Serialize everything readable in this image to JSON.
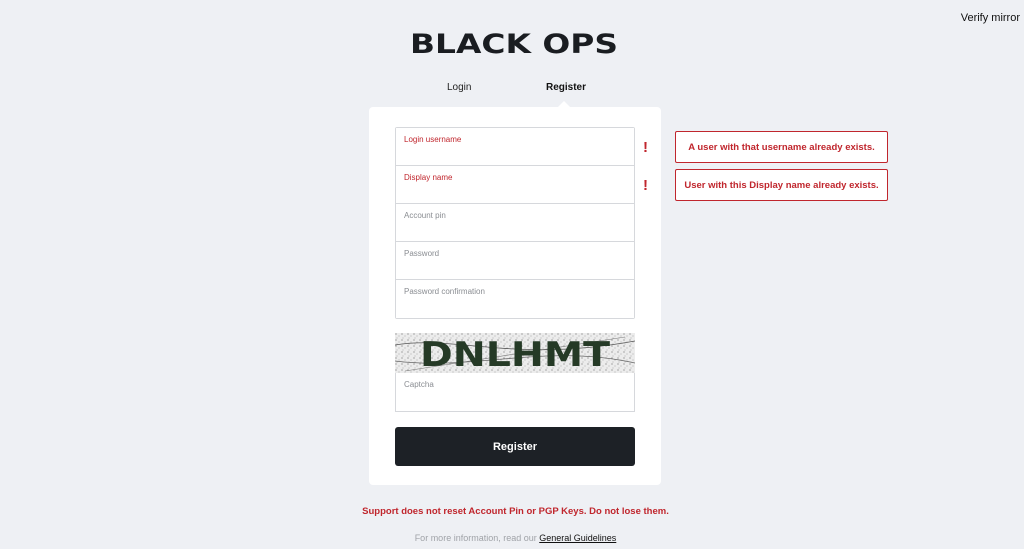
{
  "header": {
    "verify_mirror": "Verify mirror",
    "logo_text": "BLACK OPS"
  },
  "tabs": [
    {
      "label": "Login",
      "active": false
    },
    {
      "label": "Register",
      "active": true
    }
  ],
  "form": {
    "fields": [
      {
        "label": "Login username",
        "value": "",
        "error": true
      },
      {
        "label": "Display name",
        "value": "",
        "error": true
      },
      {
        "label": "Account pin",
        "value": "",
        "error": false
      },
      {
        "label": "Password",
        "value": "",
        "error": false
      },
      {
        "label": "Password confirmation",
        "value": "",
        "error": false
      }
    ],
    "captcha_text": "DNLHMT",
    "captcha_label": "Captcha",
    "submit_label": "Register"
  },
  "errors": {
    "mark": "!",
    "username": "A user with that username already exists.",
    "display_name": "User with this Display name already exists."
  },
  "footer": {
    "warning": "Support does not reset Account Pin or PGP Keys. Do not lose them.",
    "info_prefix": "For more information, read our ",
    "guidelines_link": "General Guidelines"
  },
  "colors": {
    "background": "#eef0f4",
    "error": "#c0262d",
    "button": "#1d2126"
  }
}
